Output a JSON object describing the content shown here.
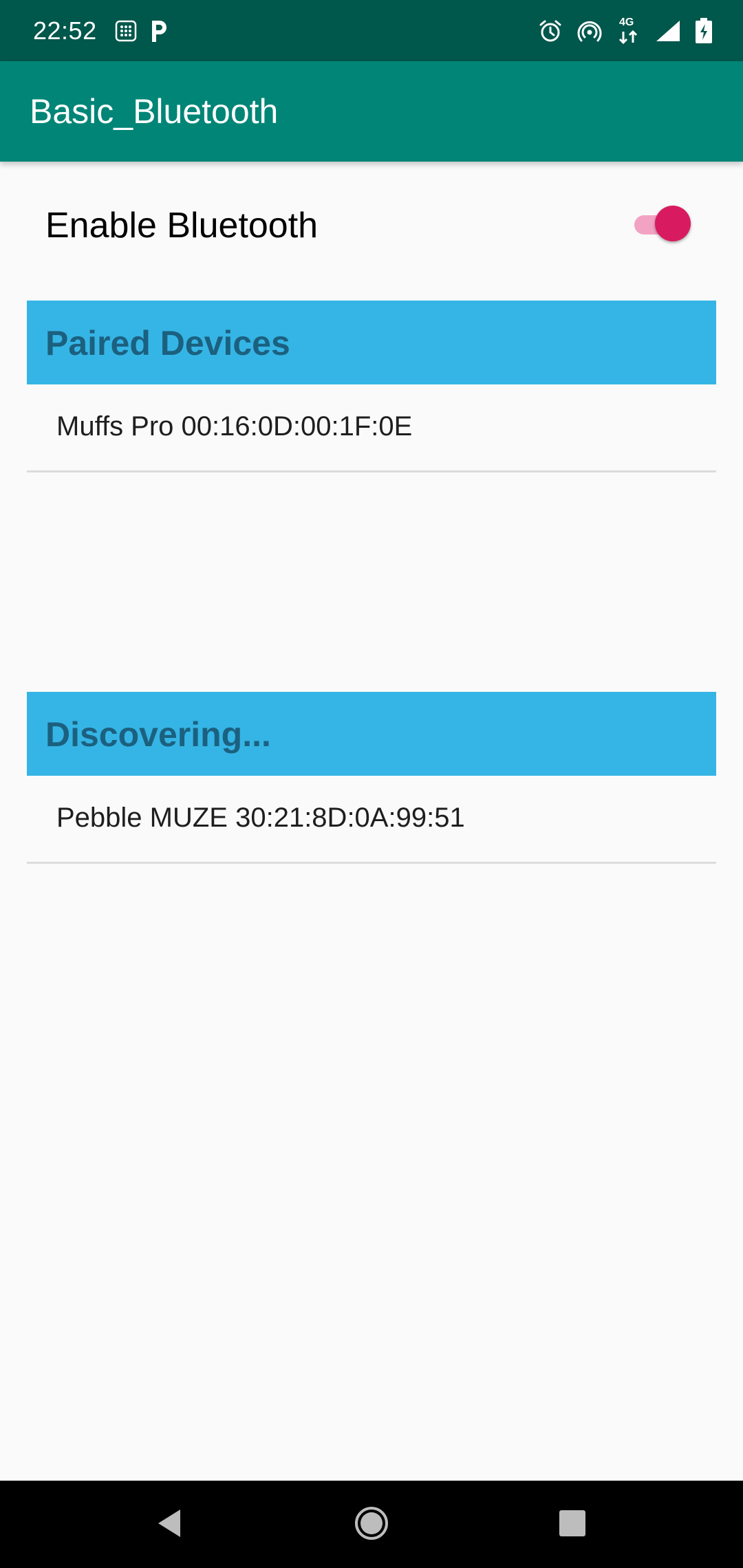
{
  "status_bar": {
    "time": "22:52",
    "network_label": "4G",
    "left_icons": [
      "sim-toolkit-icon",
      "parking-icon"
    ],
    "right_icons": [
      "alarm-icon",
      "hotspot-icon",
      "network-4g-icon",
      "signal-icon",
      "battery-charging-icon"
    ]
  },
  "app_bar": {
    "title": "Basic_Bluetooth",
    "color": "#008577"
  },
  "bluetooth_toggle": {
    "label": "Enable Bluetooth",
    "checked": true,
    "accent_color": "#d81b60"
  },
  "paired_section": {
    "header": "Paired Devices",
    "devices": [
      "Muffs Pro 00:16:0D:00:1F:0E"
    ]
  },
  "discover_section": {
    "header": "Discovering...",
    "devices": [
      "Pebble MUZE 30:21:8D:0A:99:51"
    ]
  },
  "nav_bar": {
    "buttons": [
      "back-icon",
      "home-icon",
      "recents-icon"
    ]
  },
  "colors": {
    "status_bar": "#00574b",
    "section_header_bg": "#35b5e5",
    "section_header_text": "#1c607f"
  }
}
